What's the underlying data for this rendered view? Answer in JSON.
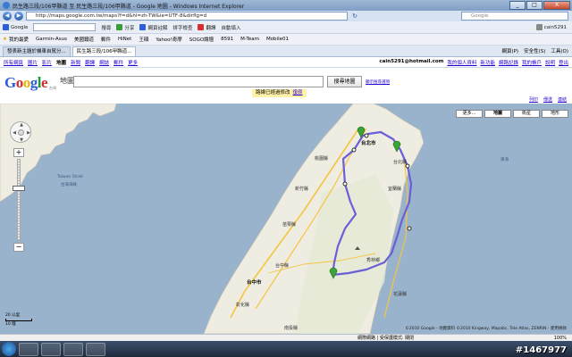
{
  "window": {
    "title": "民生路三段/106甲縣道 至 民生路三段/106甲縣道 - Google 地圖 - Windows Internet Explorer",
    "min": "_",
    "max": "□",
    "close": "X"
  },
  "address": {
    "url": "http://maps.google.com.tw/maps?f=d&hl=zh-TW&ie=UTF-8&dirflg=d",
    "search_placeholder": "Google"
  },
  "toolbar": {
    "search_label": "Google",
    "items": [
      "搜尋",
      "分享",
      "網頁註解",
      "拼字檢查",
      "翻譯",
      "自動填入",
      "cain5291"
    ]
  },
  "favorites": {
    "label": "我的最愛",
    "items": [
      "Garmin-Asus",
      "美國鐵道",
      "郵件",
      "HiNet",
      "王碩",
      "Yahoo!奇摩",
      "SOGO論壇",
      "8591",
      "M-Team",
      "Mobile01"
    ]
  },
  "tabs": [
    "發表新主題於機車自駕分...",
    "民生路三段/106甲縣道..."
  ],
  "page_tools": [
    "網頁(P)",
    "安全性(S)",
    "工具(O)"
  ],
  "gbar": {
    "items": [
      "所有網頁",
      "圖片",
      "影片",
      "地圖",
      "新聞",
      "翻譯",
      "網誌",
      "郵件",
      "更多"
    ],
    "current": "地圖",
    "right": [
      "cain5291@hotmail.com",
      "我的個人資料",
      "新功能",
      "網路記錄",
      "我的帳戶",
      "說明",
      "登出"
    ]
  },
  "header": {
    "logo_letters": [
      "G",
      "o",
      "o",
      "g",
      "l",
      "e"
    ],
    "logo_colors": [
      "#2b5fd8",
      "#d92c2c",
      "#f0b400",
      "#2b5fd8",
      "#199a3e",
      "#d92c2c"
    ],
    "logo_sub": "台灣",
    "map_label": "地圖",
    "search_button": "搜尋地圖",
    "options_link": "顯示搜尋選項",
    "traffic_note": "路線已經過修改",
    "traffic_undo": "復原",
    "links": [
      "列印",
      "傳送",
      "連結"
    ]
  },
  "map": {
    "more_button": "更多...",
    "types": [
      "地圖",
      "衛星",
      "地形"
    ],
    "active_type": "地圖",
    "scale_top": "20 公里",
    "scale_bottom": "10 哩",
    "copyright": "©2010 Google - 地圖資料 ©2010 Kingway, Mapabc, Tele Atlas, ZENRIN - 使用條款",
    "labels": {
      "taipei": "台北市",
      "taoyuan": "桃園縣",
      "hsinchu": "新竹縣",
      "miaoli": "苗栗縣",
      "taichung": "台中縣",
      "taichung_city": "台中市",
      "changhua": "彰化縣",
      "nantou": "南投縣",
      "yilan": "宜蘭縣",
      "hualien": "花蓮縣",
      "xiulin": "秀林鄉",
      "keelung": "台北縣",
      "sea1": "Taiwan Strait",
      "sea2": "台灣海峽",
      "pacific": "東海"
    }
  },
  "status": {
    "zone": "網際網路 | 受保護模式: 關閉",
    "zoom": "100%"
  },
  "watermark": "#1467977",
  "route_color": "#6a5fd6"
}
